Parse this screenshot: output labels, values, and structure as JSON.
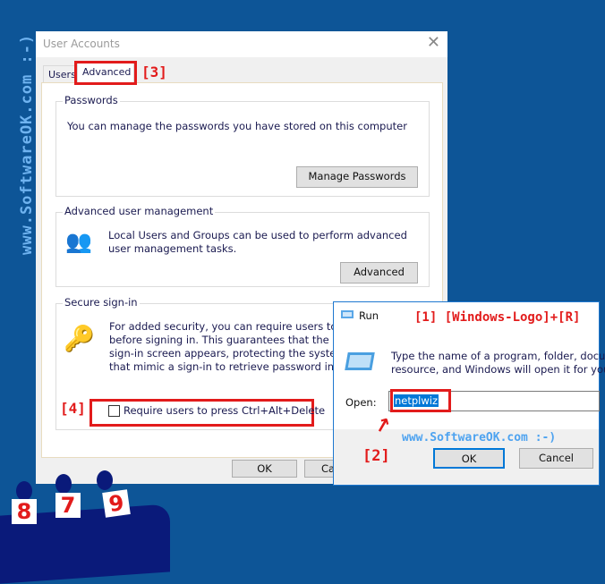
{
  "watermark_side": "www.SoftwareOK.com :-)",
  "watermark_run": "www.SoftwareOK.com :-)",
  "user_accounts": {
    "title": "User Accounts",
    "tabs": [
      {
        "label": "Users"
      },
      {
        "label": "Advanced",
        "active": true
      }
    ],
    "passwords": {
      "label": "Passwords",
      "text": "You can manage the passwords you have stored on this computer",
      "button": "Manage Passwords"
    },
    "advanced_mgmt": {
      "label": "Advanced user management",
      "text": "Local Users and Groups can be used to perform advanced user management tasks.",
      "button": "Advanced"
    },
    "secure_signin": {
      "label": "Secure sign-in",
      "lines": [
        "For added security, you can require users to pre",
        "before signing in. This guarantees that the auth",
        "sign-in screen appears, protecting the system fr",
        "that mimic a sign-in to retrieve password info."
      ],
      "checkbox": "Require users to press Ctrl+Alt+Delete",
      "checked": false
    },
    "ok": "OK",
    "cancel": "Ca"
  },
  "run": {
    "title": "Run",
    "desc1": "Type the name of a program, folder, docume",
    "desc2": "resource, and Windows will open it for you.",
    "open_label": "Open:",
    "open_value": "netplwiz",
    "ok": "OK",
    "cancel": "Cancel"
  },
  "annotations": {
    "a1": "[1] [Windows-Logo]+[R]",
    "a2": "[2]",
    "a3": "[3]",
    "a4": "[4]"
  },
  "figures": [
    "8",
    "7",
    "9"
  ],
  "colors": {
    "background": "#0d5597",
    "annotation": "#e21b1b",
    "watermark": "#6fb3f0"
  }
}
